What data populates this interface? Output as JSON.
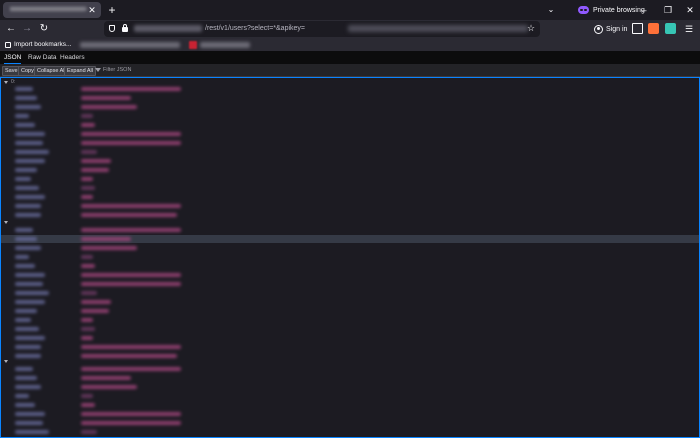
{
  "browser": {
    "private_label": "Private browsing",
    "sign_in_label": "Sign in",
    "url_visible": "/rest/v1/users?select=*&apikey=",
    "icons": [
      "close-icon",
      "plus-icon",
      "chevron-down-icon",
      "private-mask-icon",
      "minimize-icon",
      "restore-icon",
      "back-icon",
      "forward-icon",
      "reload-icon",
      "shield-icon",
      "lock-icon",
      "star-icon",
      "account-icon",
      "extension-icon",
      "menu-icon"
    ],
    "colors": {
      "accent": "#0a84ff",
      "private": "#9059ff",
      "chrome": "#2b2a33",
      "content": "#1c1b22"
    }
  },
  "bookmarks": {
    "import_label": "Import bookmarks..."
  },
  "viewer": {
    "tabs": [
      {
        "label": "JSON",
        "active": true
      },
      {
        "label": "Raw Data",
        "active": false
      },
      {
        "label": "Headers",
        "active": false
      }
    ],
    "toolbar": {
      "save": "Save",
      "copy": "Copy",
      "collapse_all": "Collapse All",
      "expand_all": "Expand All",
      "filter_placeholder": "Filter JSON"
    },
    "root_label": "0:"
  }
}
